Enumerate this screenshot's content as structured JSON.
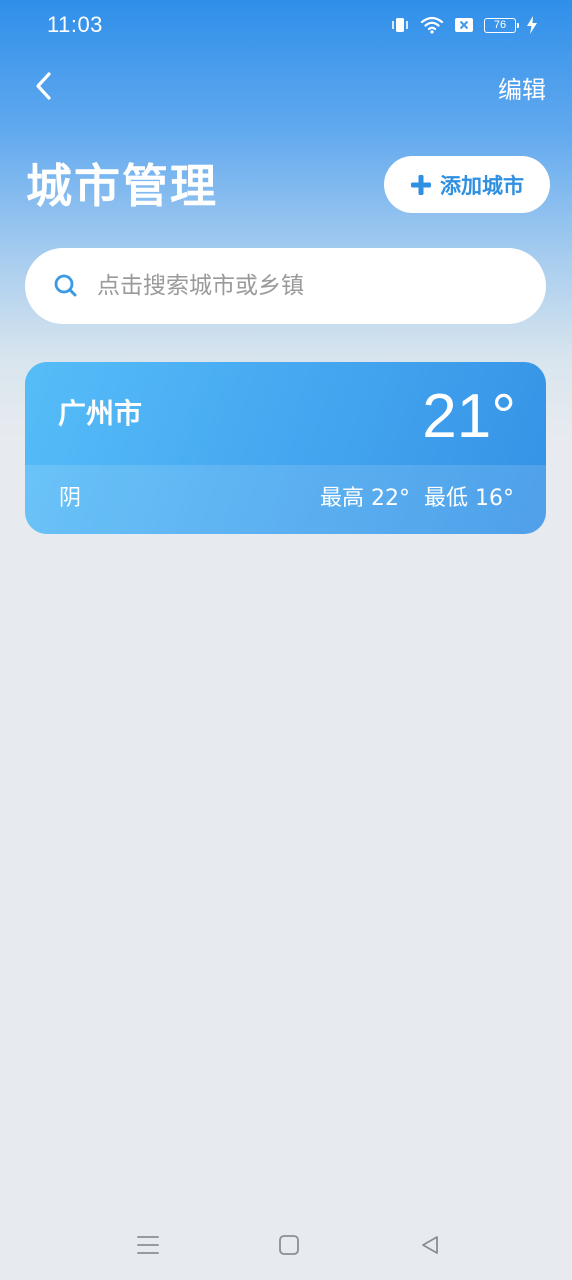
{
  "status_bar": {
    "time": "11:03",
    "battery_level": "76",
    "icons": [
      "vibrate-icon",
      "wifi-icon",
      "sim-blocked-icon",
      "battery-icon",
      "charging-icon"
    ]
  },
  "header": {
    "back_icon": "chevron-left-icon",
    "edit_label": "编辑",
    "title": "城市管理",
    "add_city_label": "添加城市"
  },
  "search": {
    "placeholder": "点击搜索城市或乡镇",
    "value": ""
  },
  "cities": [
    {
      "name": "广州市",
      "temperature": "21°",
      "weather": "阴",
      "high": "最高 22°",
      "low": "最低 16°"
    }
  ],
  "nav_bar": {
    "icons": [
      "menu-icon",
      "home-icon",
      "back-triangle-icon"
    ]
  },
  "colors": {
    "header_gradient_top": "#2f8fe9",
    "accent_blue": "#2f8fe0",
    "card_gradient_start": "#56bdf8",
    "card_gradient_end": "#3592e6",
    "page_background": "#e7ebef"
  }
}
